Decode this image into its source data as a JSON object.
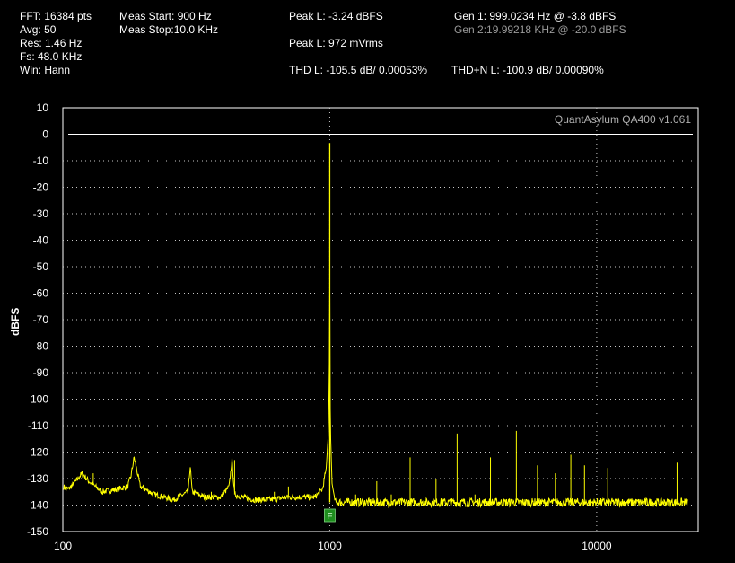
{
  "header": {
    "col1": [
      "FFT: 16384 pts",
      "Avg: 50",
      "Res: 1.46 Hz",
      "Fs: 48.0 KHz",
      "Win: Hann"
    ],
    "col2": [
      "Meas Start: 900 Hz",
      "Meas Stop:10.0 KHz"
    ],
    "peak_level": "Peak L: -3.24 dBFS",
    "peak_rms": "Peak L: 972 mVrms",
    "thd": "THD L: -105.5 dB/ 0.00053%",
    "thdn": "THD+N L: -100.9 dB/ 0.00090%",
    "gen1": "Gen 1: 999.0234 Hz @ -3.8  dBFS",
    "gen2": "Gen 2:19.99218 KHz @ -20.0  dBFS"
  },
  "watermark": "QuantAsylum QA400 v1.061",
  "marker_label": "F",
  "colors": {
    "trace": "#ffff00",
    "grid": "#c8c8c8",
    "frame": "#ffffff",
    "marker": "#1f8f1f",
    "watermark": "#b0b0b0"
  },
  "chart_data": {
    "type": "line",
    "xscale": "log",
    "xlim": [
      100,
      24000
    ],
    "ylim": [
      -150,
      10
    ],
    "ylabel": "dBFS",
    "xticks": [
      100,
      1000,
      10000
    ],
    "xtick_labels": [
      "100",
      "1000",
      "10000"
    ],
    "yticks": [
      10,
      0,
      -10,
      -20,
      -30,
      -40,
      -50,
      -60,
      -70,
      -80,
      -90,
      -100,
      -110,
      -120,
      -130,
      -140,
      -150
    ],
    "ytick_labels": [
      "10",
      "0",
      "-10",
      "-20",
      "-30",
      "-40",
      "-50",
      "-60",
      "-70",
      "-80",
      "-90",
      "-100",
      "-110",
      "-120",
      "-130",
      "-140",
      "-150"
    ],
    "reference_line": 0,
    "marker_freq": 1000,
    "series": [
      {
        "values": {
          "x": [
            100,
            105,
            112,
            118,
            125,
            140,
            160,
            175,
            180,
            185,
            195,
            220,
            260,
            295,
            300,
            305,
            340,
            390,
            420,
            430,
            440,
            470,
            520,
            600,
            700,
            800,
            880,
            940,
            970,
            985,
            993,
            997,
            999,
            1001,
            1003,
            1008,
            1020,
            1050,
            1100,
            1200,
            1300,
            1400,
            1500,
            1800,
            2000,
            2500,
            2990,
            3000,
            3010,
            3500,
            4000,
            5000,
            6000,
            7000,
            8000,
            9000,
            10000,
            11000,
            12000,
            14000,
            16000,
            18000,
            20000,
            21000,
            22000
          ],
          "y": [
            -133,
            -134,
            -131,
            -128,
            -131,
            -135,
            -134,
            -133,
            -129,
            -122,
            -133,
            -136,
            -138,
            -135,
            -125,
            -135,
            -137,
            -137,
            -133,
            -123,
            -136,
            -137,
            -138,
            -138,
            -137,
            -137,
            -137,
            -134,
            -126,
            -115,
            -100,
            -85,
            -3.3,
            -85,
            -100,
            -115,
            -132,
            -139,
            -139,
            -139,
            -139,
            -139,
            -139,
            -139,
            -139,
            -139,
            -139,
            -139,
            -139,
            -139,
            -139,
            -139,
            -139,
            -139,
            -139,
            -139,
            -139,
            -139,
            -139,
            -139,
            -139,
            -139,
            -139,
            -139,
            -139
          ]
        },
        "spurs": [
          {
            "x": 1500,
            "y": -131
          },
          {
            "x": 2000,
            "y": -122
          },
          {
            "x": 2500,
            "y": -130
          },
          {
            "x": 3000,
            "y": -113
          },
          {
            "x": 4000,
            "y": -122
          },
          {
            "x": 5000,
            "y": -112
          },
          {
            "x": 6000,
            "y": -125
          },
          {
            "x": 7000,
            "y": -128
          },
          {
            "x": 8000,
            "y": -121
          },
          {
            "x": 9000,
            "y": -125
          },
          {
            "x": 11000,
            "y": -126
          },
          {
            "x": 20000,
            "y": -124
          },
          {
            "x": 130,
            "y": -128
          },
          {
            "x": 360,
            "y": -135
          },
          {
            "x": 440,
            "y": -123
          },
          {
            "x": 620,
            "y": -135
          },
          {
            "x": 700,
            "y": -133
          },
          {
            "x": 1250,
            "y": -136
          },
          {
            "x": 1700,
            "y": -136
          },
          {
            "x": 3500,
            "y": -136
          }
        ]
      }
    ]
  }
}
